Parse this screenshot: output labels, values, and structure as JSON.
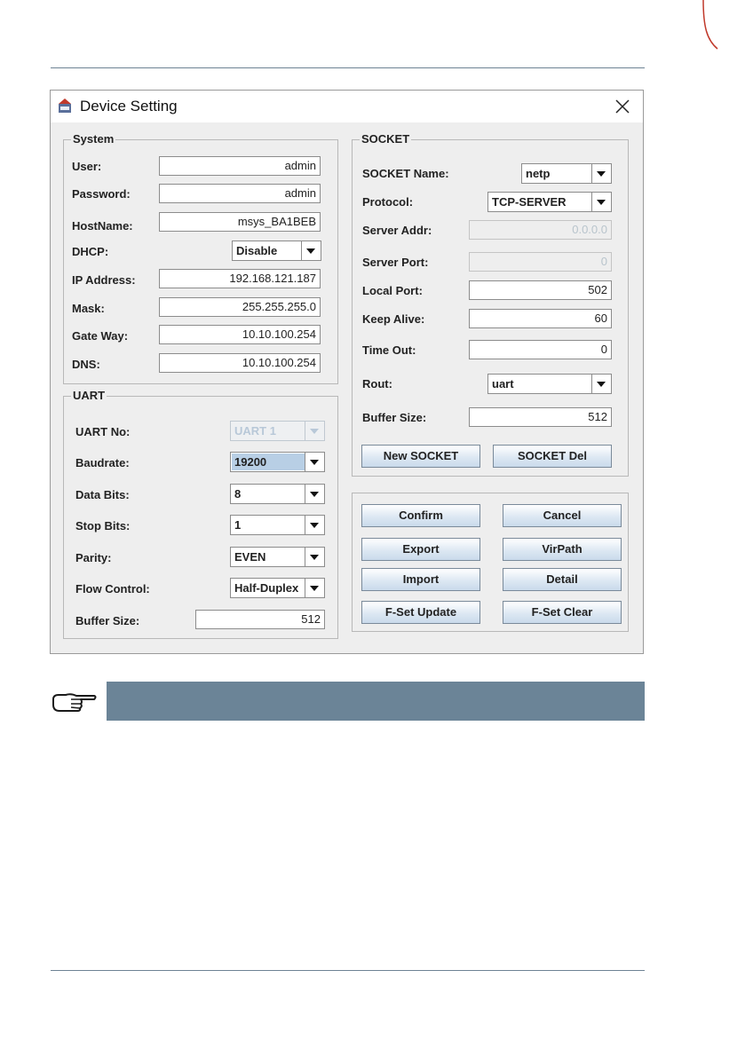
{
  "window": {
    "title": "Device Setting"
  },
  "system": {
    "title": "System",
    "fields": {
      "user": {
        "label": "User:",
        "value": "admin"
      },
      "password": {
        "label": "Password:",
        "value": "admin"
      },
      "hostname": {
        "label": "HostName:",
        "value": "msys_BA1BEB"
      },
      "dhcp": {
        "label": "DHCP:",
        "value": "Disable"
      },
      "ip": {
        "label": "IP Address:",
        "value": "192.168.121.187"
      },
      "mask": {
        "label": "Mask:",
        "value": "255.255.255.0"
      },
      "gateway": {
        "label": "Gate Way:",
        "value": "10.10.100.254"
      },
      "dns": {
        "label": "DNS:",
        "value": "10.10.100.254"
      }
    }
  },
  "uart": {
    "title": "UART",
    "fields": {
      "uart_no": {
        "label": "UART No:",
        "value": "UART 1"
      },
      "baudrate": {
        "label": "Baudrate:",
        "value": "19200"
      },
      "data_bits": {
        "label": "Data Bits:",
        "value": "8"
      },
      "stop_bits": {
        "label": "Stop Bits:",
        "value": "1"
      },
      "parity": {
        "label": "Parity:",
        "value": "EVEN"
      },
      "flow_control": {
        "label": "Flow Control:",
        "value": "Half-Duplex"
      },
      "buffer_size": {
        "label": "Buffer Size:",
        "value": "512"
      }
    }
  },
  "socket": {
    "title": "SOCKET",
    "fields": {
      "name": {
        "label": "SOCKET Name:",
        "value": "netp"
      },
      "protocol": {
        "label": "Protocol:",
        "value": "TCP-SERVER"
      },
      "server_addr": {
        "label": "Server Addr:",
        "value": "0.0.0.0"
      },
      "server_port": {
        "label": "Server Port:",
        "value": "0"
      },
      "local_port": {
        "label": "Local Port:",
        "value": "502"
      },
      "keep_alive": {
        "label": "Keep Alive:",
        "value": "60"
      },
      "time_out": {
        "label": "Time Out:",
        "value": "0"
      },
      "rout": {
        "label": "Rout:",
        "value": "uart"
      },
      "buffer_size": {
        "label": "Buffer Size:",
        "value": "512"
      }
    },
    "buttons": {
      "new": "New SOCKET",
      "del": "SOCKET Del"
    }
  },
  "actions": {
    "confirm": "Confirm",
    "cancel": "Cancel",
    "export": "Export",
    "virpath": "VirPath",
    "import": "Import",
    "detail": "Detail",
    "fset_update": "F-Set Update",
    "fset_clear": "F-Set Clear"
  },
  "icons": {
    "title_icon": "app-icon",
    "close": "close-icon",
    "note": "pointing-hand-icon"
  },
  "colors": {
    "note_bar": "#6b8497",
    "rule": "#6d8294",
    "selected_highlight": "#b8cfe5"
  }
}
